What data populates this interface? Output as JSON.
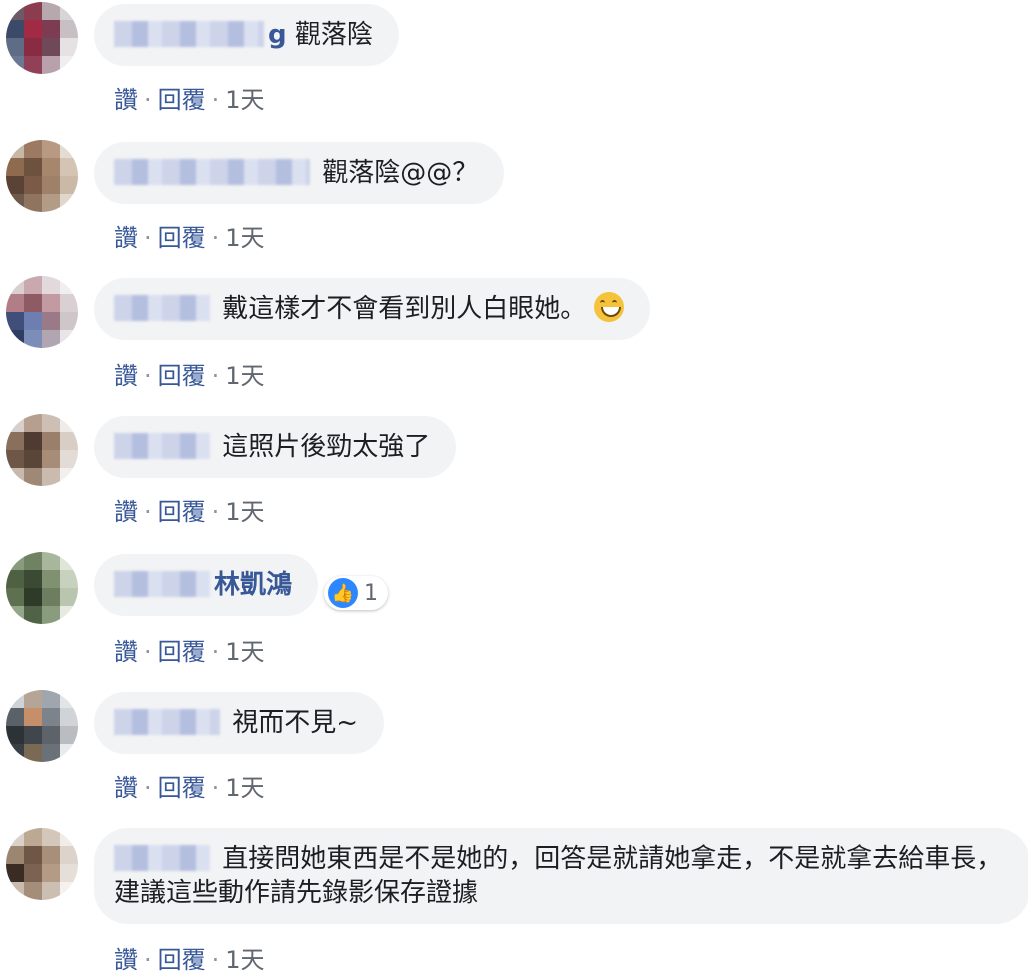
{
  "actions": {
    "like": "讚",
    "reply": "回覆",
    "time": "1天",
    "sep": "·"
  },
  "comments": [
    {
      "text": "觀落陰",
      "name_tail": "g"
    },
    {
      "text": "觀落陰@@？"
    },
    {
      "text": "戴這樣才不會看到別人白眼她。",
      "emoji": "grinning-face-icon"
    },
    {
      "text": "這照片後勁太強了"
    },
    {
      "text": "林凱鴻",
      "reaction_count": "1",
      "reaction_icon": "like-icon"
    },
    {
      "text": "視而不見~"
    },
    {
      "text": "直接問她東西是不是她的，回答是就請她拿走，不是就拿去給車長，建議這些動作請先錄影保存證據"
    }
  ]
}
